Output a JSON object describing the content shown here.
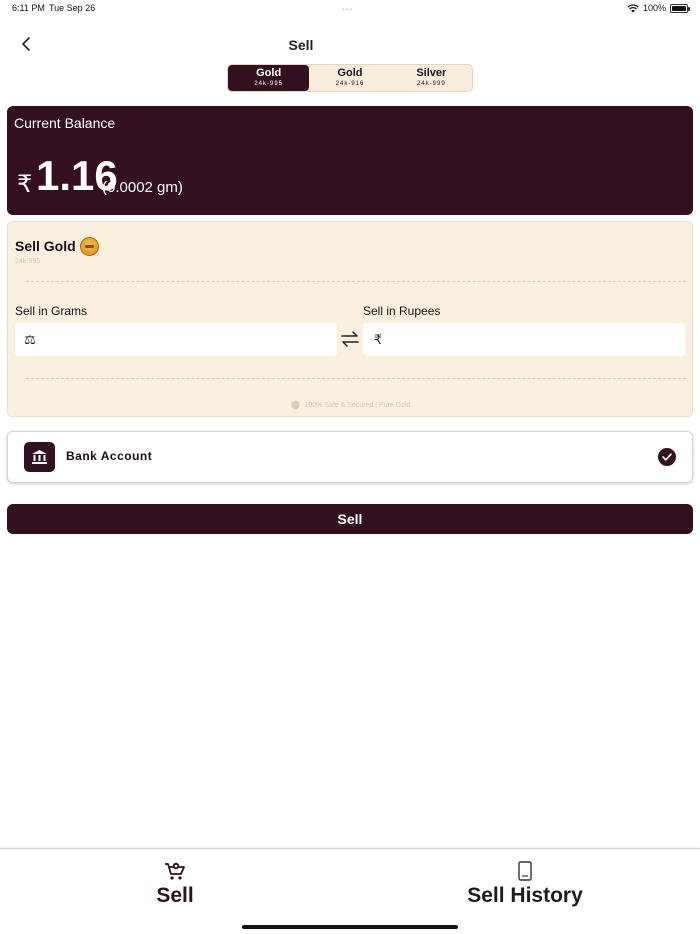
{
  "status_bar": {
    "time": "6:11 PM",
    "date": "Tue Sep 26",
    "battery": "100%"
  },
  "header": {
    "title": "Sell"
  },
  "metal_tabs": [
    {
      "label": "Gold",
      "sub": "24k-995",
      "active": true
    },
    {
      "label": "Gold",
      "sub": "24k-916",
      "active": false
    },
    {
      "label": "Silver",
      "sub": "24k-999",
      "active": false
    }
  ],
  "balance": {
    "title": "Current Balance",
    "currency": "₹",
    "value": "1.16",
    "grams": "(0.0002 gm)"
  },
  "sell_form": {
    "title": "Sell Gold",
    "karat": "24k-995",
    "grams_label": "Sell in Grams",
    "rupees_label": "Sell in Rupees",
    "grams_prefix": "⚖",
    "rupees_prefix": "₹",
    "grams_value": "",
    "rupees_value": "",
    "safe_note": "100% Safe & Secured | Pure Gold"
  },
  "payout": {
    "label": "Bank Account",
    "selected": true
  },
  "actions": {
    "sell_label": "Sell"
  },
  "tab_bar": {
    "sell_label": "Sell",
    "history_label": "Sell History"
  },
  "colors": {
    "primary": "#33101f",
    "panel": "#f9f0df",
    "segment_bg": "#f8eedb"
  },
  "icons": [
    "back-icon",
    "wifi-icon",
    "battery-icon",
    "coin-icon",
    "scale-icon",
    "swap-icon",
    "shield-icon",
    "bank-icon",
    "check-icon",
    "cart-icon",
    "receipt-icon"
  ]
}
